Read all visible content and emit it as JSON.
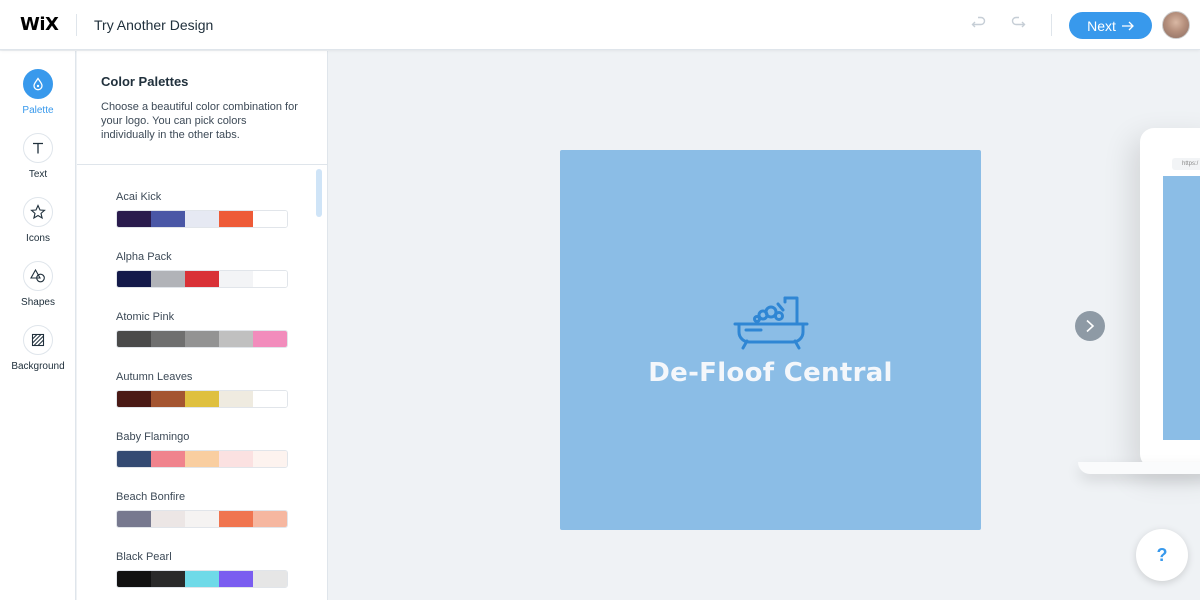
{
  "header": {
    "logo": "WiX",
    "title": "Try Another Design",
    "undo_icon": "undo-icon",
    "redo_icon": "redo-icon",
    "next_label": "Next",
    "accent": "#3899ec"
  },
  "rail": {
    "items": [
      {
        "label": "Palette",
        "icon": "palette-drop-icon",
        "active": true
      },
      {
        "label": "Text",
        "icon": "text-icon"
      },
      {
        "label": "Icons",
        "icon": "star-icon"
      },
      {
        "label": "Shapes",
        "icon": "shapes-icon"
      },
      {
        "label": "Background",
        "icon": "background-icon"
      }
    ]
  },
  "panel": {
    "title": "Color Palettes",
    "description": "Choose a beautiful color combination for your logo. You can pick colors individually in the other tabs.",
    "palettes": [
      {
        "name": "Acai Kick",
        "colors": [
          "#2a1b4d",
          "#4a57a6",
          "#e6e9f3",
          "#ee5b38",
          "#ffffff"
        ]
      },
      {
        "name": "Alpha Pack",
        "colors": [
          "#141a4a",
          "#b1b3b8",
          "#d93137",
          "#f3f4f6",
          "#ffffff"
        ]
      },
      {
        "name": "Atomic Pink",
        "colors": [
          "#4a4a4a",
          "#6f6f6f",
          "#939393",
          "#c0c0c0",
          "#f28cbc"
        ]
      },
      {
        "name": "Autumn Leaves",
        "colors": [
          "#4a1a16",
          "#a45531",
          "#dfc03f",
          "#efebe0",
          "#ffffff"
        ]
      },
      {
        "name": "Baby Flamingo",
        "colors": [
          "#344a72",
          "#f0838d",
          "#f9cea0",
          "#fbe1e1",
          "#fdf3ef"
        ]
      },
      {
        "name": "Beach Bonfire",
        "colors": [
          "#77798f",
          "#ece6e5",
          "#f5f3f2",
          "#f07550",
          "#f6b7a0"
        ]
      },
      {
        "name": "Black Pearl",
        "colors": [
          "#111111",
          "#2a2a2a",
          "#6fdae8",
          "#7a5df0",
          "#e6e6e6"
        ]
      }
    ]
  },
  "canvas": {
    "logo_text": "De-Floof Central",
    "logo_icon": "bathtub-icon",
    "background": "#8bbde6"
  },
  "preview": {
    "url_text": "https:/"
  },
  "help_label": "?"
}
